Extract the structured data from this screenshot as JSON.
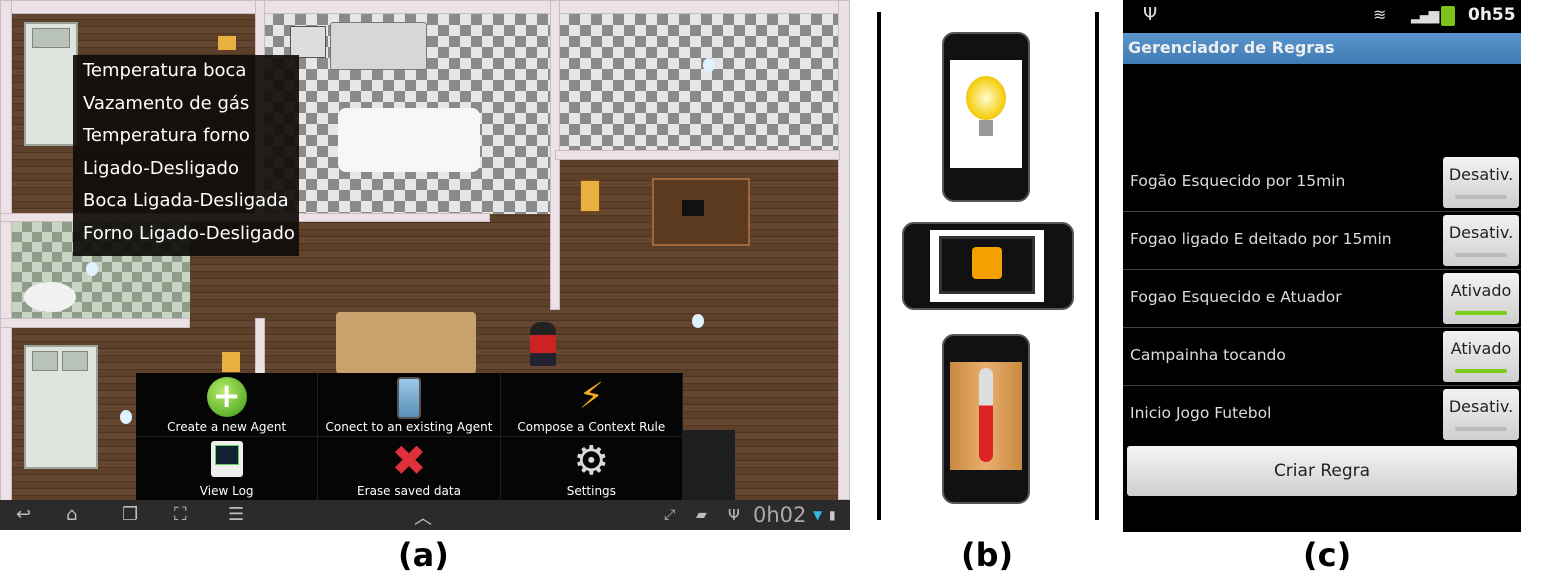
{
  "panel_a": {
    "context_menu": [
      "Temperatura boca",
      "Vazamento de gás",
      "Temperatura forno",
      "Ligado-Desligado",
      "Boca Ligada-Desligada",
      "Forno Ligado-Desligado"
    ],
    "options_menu": [
      {
        "label": "Create a new Agent",
        "icon": "add-icon"
      },
      {
        "label": "Conect to an existing Agent",
        "icon": "phone-icon"
      },
      {
        "label": "Compose a Context Rule",
        "icon": "lightning-icon"
      },
      {
        "label": "View Log",
        "icon": "log-icon"
      },
      {
        "label": "Erase saved data",
        "icon": "delete-icon"
      },
      {
        "label": "Settings",
        "icon": "gear-icon"
      }
    ],
    "status_time": "0h02"
  },
  "panel_c": {
    "status_time": "0h55",
    "title": "Gerenciador de Regras",
    "rules": [
      {
        "name": "Fogão Esquecido por 15min",
        "state": "Desativ.",
        "on": false
      },
      {
        "name": "Fogao ligado E deitado por 15min",
        "state": "Desativ.",
        "on": false
      },
      {
        "name": "Fogao Esquecido e Atuador",
        "state": "Ativado",
        "on": true
      },
      {
        "name": "Campainha tocando",
        "state": "Ativado",
        "on": true
      },
      {
        "name": "Inicio Jogo Futebol",
        "state": "Desativ.",
        "on": false
      }
    ],
    "create_button": "Criar Regra"
  },
  "captions": {
    "a": "(a)",
    "b": "(b)",
    "c": "(c)"
  },
  "colors": {
    "title_bar": "#4a86c0",
    "active": "#7ccc1c"
  }
}
